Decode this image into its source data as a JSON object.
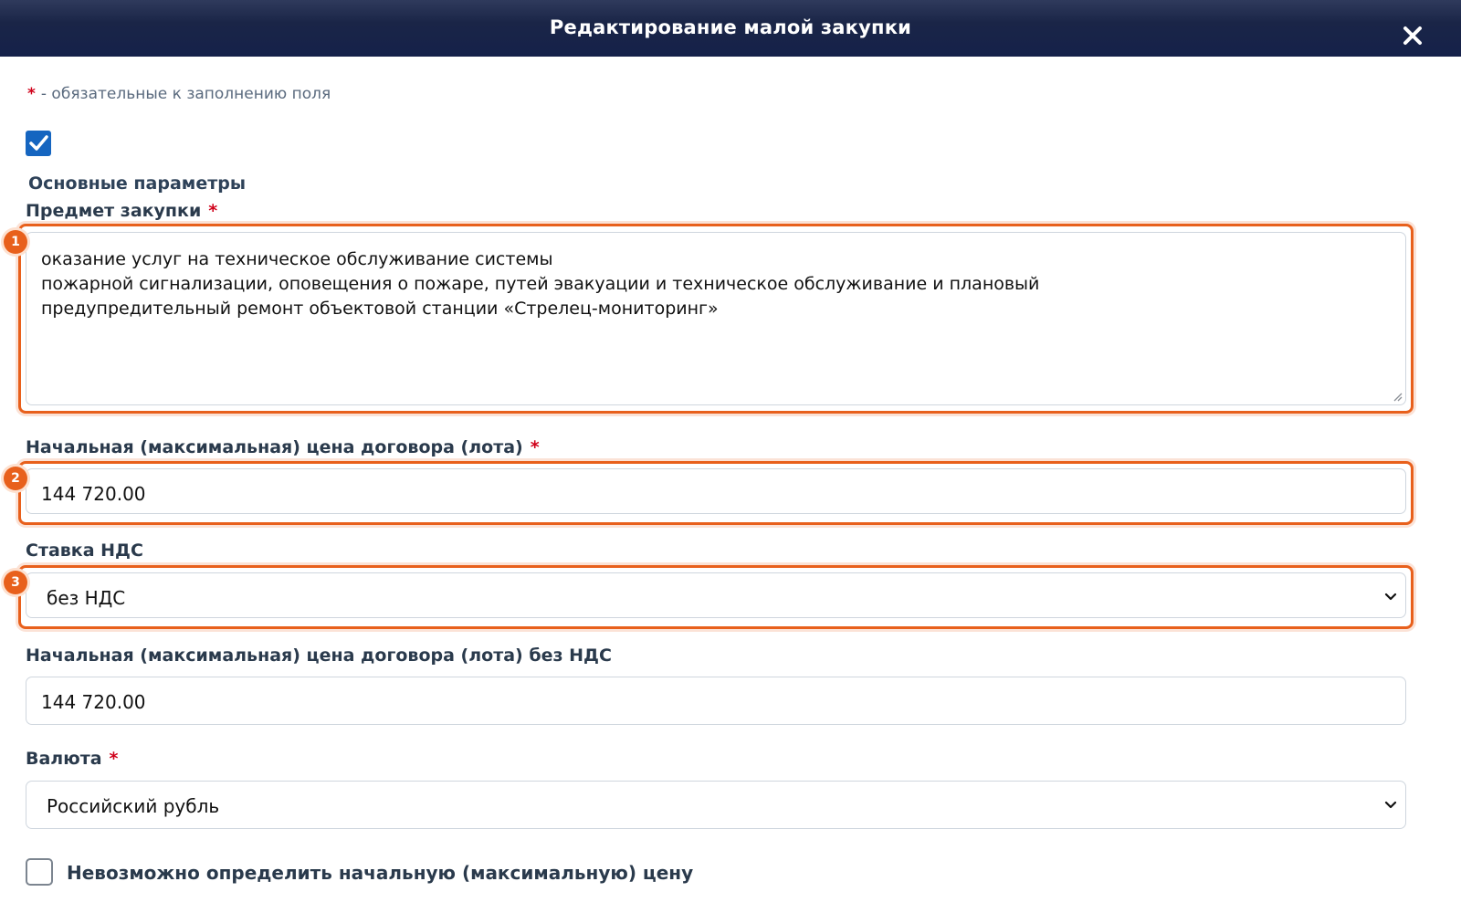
{
  "modal": {
    "title": "Редактирование малой закупки",
    "close_icon": "close-icon"
  },
  "required_note": {
    "star": "*",
    "text": "- обязательные к заполнению поля"
  },
  "section": {
    "toggle_checked": true,
    "title": "Основные параметры"
  },
  "fields": {
    "subject": {
      "label": "Предмет закупки",
      "required_mark": "*",
      "lines": [
        "оказание услуг на техническое обслуживание системы",
        "пожарной сигнализации, оповещения о пожаре, путей эвакуации и техническое обслуживание и плановый",
        "предупредительный ремонт объектовой станции «Стрелец-мониторинг»"
      ],
      "badge": "1"
    },
    "initial_price": {
      "label": "Начальная (максимальная) цена договора (лота)",
      "required_mark": "*",
      "value": "144 720.00",
      "badge": "2"
    },
    "vat_rate": {
      "label": "Ставка НДС",
      "value": "без НДС",
      "badge": "3"
    },
    "price_without_vat": {
      "label": "Начальная (максимальная) цена договора (лота) без НДС",
      "value": "144 720.00"
    },
    "currency": {
      "label": "Валюта",
      "required_mark": "*",
      "value": "Российский рубль"
    },
    "cannot_determine_price": {
      "label": "Невозможно определить начальную (максимальную) цену",
      "checked": false
    }
  },
  "colors": {
    "header": "#1a2547",
    "highlight": "#e8601c",
    "checkbox": "#1565c0",
    "required": "#d0021b"
  }
}
